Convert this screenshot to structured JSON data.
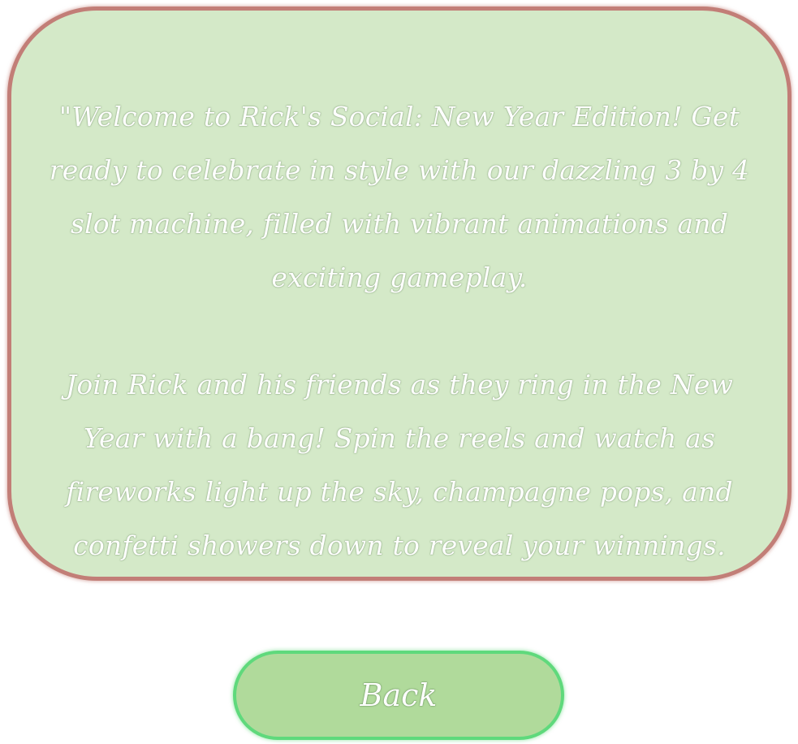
{
  "info_panel": {
    "paragraphs": [
      "\"Welcome to Rick's Social: New Year Edition! Get ready to celebrate in style with our dazzling 3 by 4 slot machine, filled with vibrant animations and exciting gameplay.",
      "Join Rick and his friends as they ring in the New Year with a bang! Spin the reels and watch as fireworks light up the sky, champagne pops, and confetti showers down to reveal your winnings."
    ]
  },
  "back_button": {
    "label": "Back"
  },
  "colors": {
    "panel_fill": "#d4e9c8",
    "panel_border": "#c27e77",
    "button_fill": "#b0da9b",
    "button_border": "#5fd97c",
    "text": "#ffffff"
  }
}
